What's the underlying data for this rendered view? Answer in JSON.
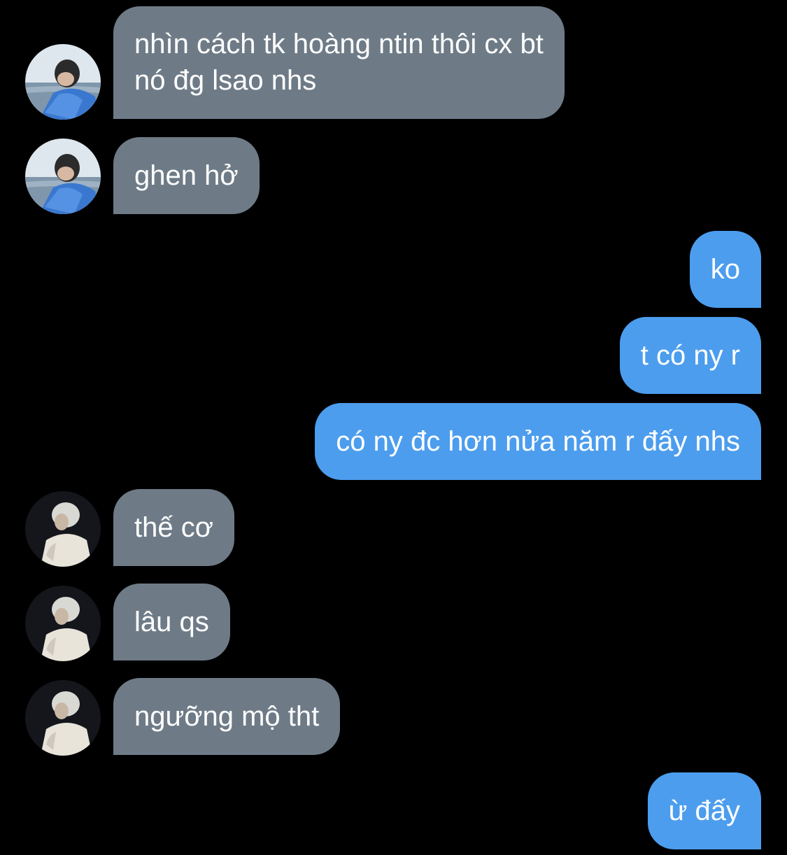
{
  "conversation": {
    "messages": [
      {
        "sender": "other-1",
        "direction": "incoming",
        "text_line1": "nhìn cách tk hoàng ntin thôi cx bt",
        "text_line2": "nó đg lsao nhs"
      },
      {
        "sender": "other-1",
        "direction": "incoming",
        "text": "ghen hở"
      },
      {
        "sender": "me",
        "direction": "outgoing",
        "text": "ko"
      },
      {
        "sender": "me",
        "direction": "outgoing",
        "text": "t có ny r"
      },
      {
        "sender": "me",
        "direction": "outgoing",
        "text": "có ny đc hơn nửa năm r đấy nhs"
      },
      {
        "sender": "other-2",
        "direction": "incoming",
        "text": "thế cơ"
      },
      {
        "sender": "other-2",
        "direction": "incoming",
        "text": "lâu qs"
      },
      {
        "sender": "other-2",
        "direction": "incoming",
        "text": "ngưỡng mộ tht"
      },
      {
        "sender": "me",
        "direction": "outgoing",
        "text": "ừ đấy"
      }
    ]
  },
  "colors": {
    "background": "#000000",
    "incoming_bubble": "#6e7b87",
    "outgoing_bubble": "#4c9ded",
    "text": "#ffffff"
  },
  "icons": {
    "avatar_1": "photo-of-person-in-blue-jacket-by-sea",
    "avatar_2": "photo-of-person-with-light-hair-in-white-coat"
  }
}
